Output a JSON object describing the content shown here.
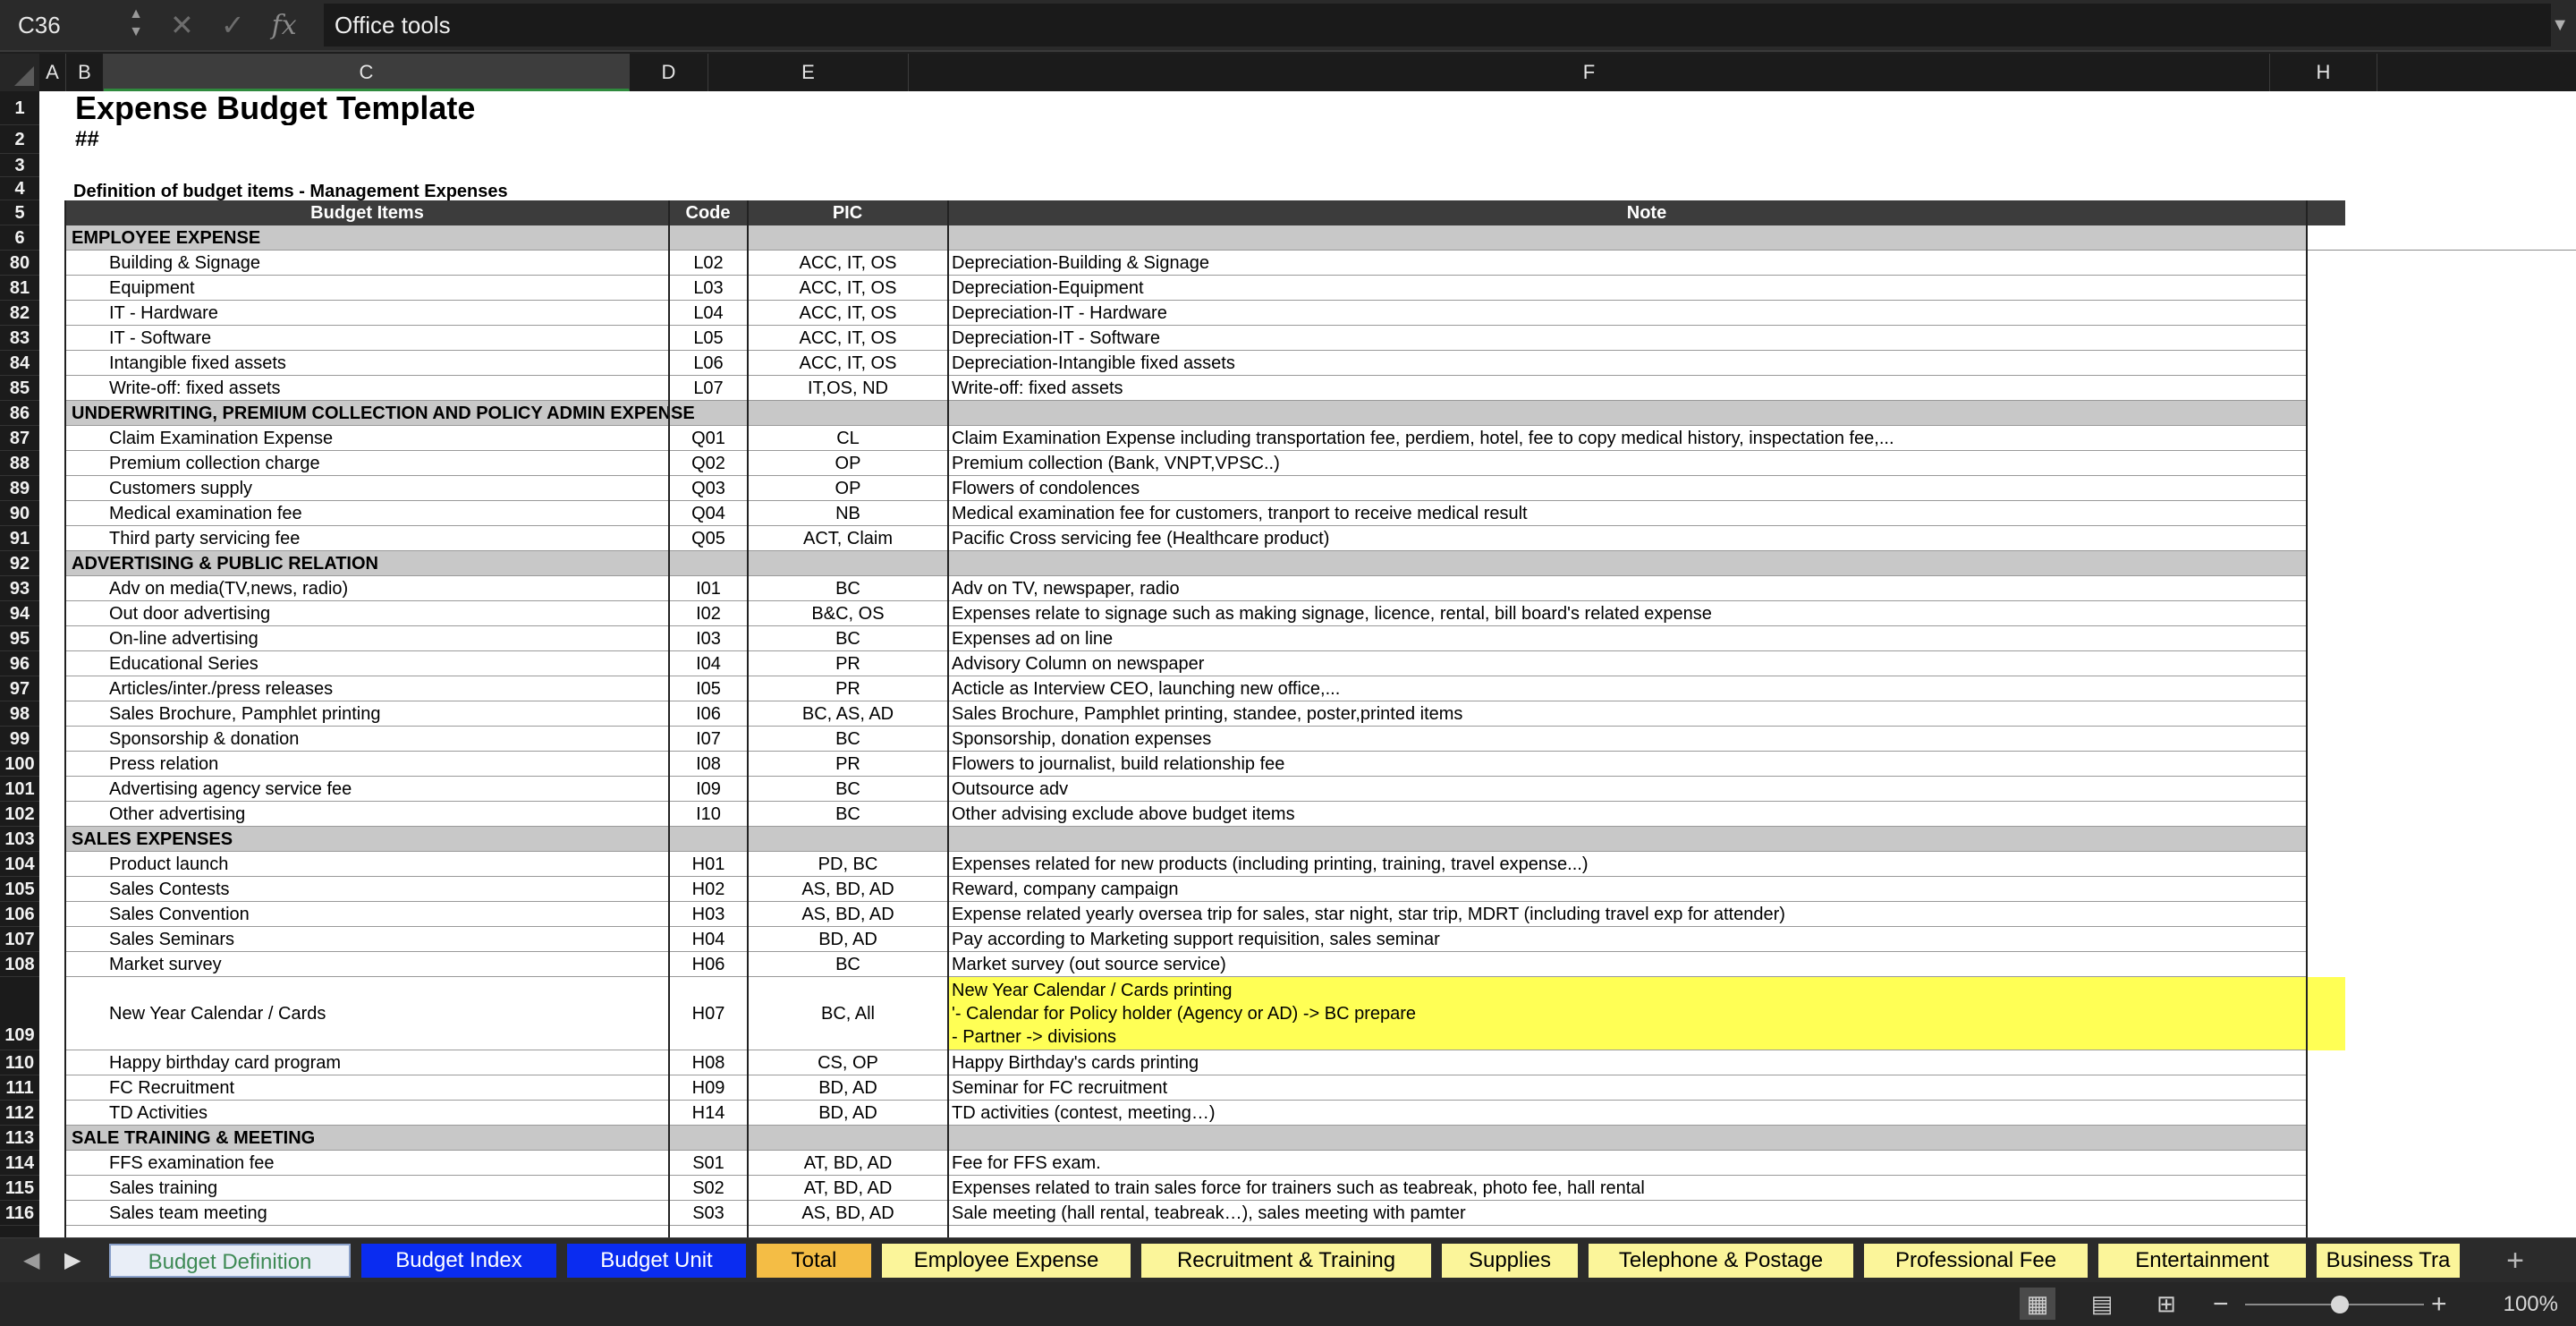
{
  "formula_bar": {
    "cell_ref": "C36",
    "cancel_icon": "✕",
    "confirm_icon": "✓",
    "fx_label": "fx",
    "value": "Office tools"
  },
  "columns": [
    "A",
    "B",
    "C",
    "D",
    "E",
    "F",
    "H"
  ],
  "sheet": {
    "title": "Expense Budget Template",
    "marker": "##",
    "section_label": "Definition of budget items - Management Expenses",
    "headers": {
      "items": "Budget Items",
      "code": "Code",
      "pic": "PIC",
      "note": "Note"
    },
    "rows": [
      {
        "n": "1",
        "kind": "title",
        "item": "Expense Budget Template"
      },
      {
        "n": "2",
        "kind": "marker",
        "item": "##"
      },
      {
        "n": "3",
        "kind": "blank"
      },
      {
        "n": "4",
        "kind": "section",
        "item": "Definition of budget items - Management Expenses"
      },
      {
        "n": "5",
        "kind": "header"
      },
      {
        "n": "6",
        "kind": "group",
        "item": "EMPLOYEE EXPENSE"
      },
      {
        "n": "80",
        "item": "Building & Signage",
        "code": "L02",
        "pic": "ACC, IT, OS",
        "note": "Depreciation-Building & Signage"
      },
      {
        "n": "81",
        "item": "Equipment",
        "code": "L03",
        "pic": "ACC, IT, OS",
        "note": "Depreciation-Equipment"
      },
      {
        "n": "82",
        "item": "IT - Hardware",
        "code": "L04",
        "pic": "ACC, IT, OS",
        "note": "Depreciation-IT - Hardware"
      },
      {
        "n": "83",
        "item": "IT - Software",
        "code": "L05",
        "pic": "ACC, IT, OS",
        "note": "Depreciation-IT - Software"
      },
      {
        "n": "84",
        "item": "Intangible fixed assets",
        "code": "L06",
        "pic": "ACC, IT, OS",
        "note": "Depreciation-Intangible fixed assets"
      },
      {
        "n": "85",
        "item": "Write-off: fixed assets",
        "code": "L07",
        "pic": "IT,OS, ND",
        "note": "Write-off: fixed assets"
      },
      {
        "n": "86",
        "kind": "group",
        "item": "UNDERWRITING, PREMIUM COLLECTION AND POLICY ADMIN EXPENSE"
      },
      {
        "n": "87",
        "item": "Claim Examination Expense",
        "code": "Q01",
        "pic": "CL",
        "note": "Claim Examination Expense including transportation fee, perdiem, hotel, fee to copy medical history, inspectation fee,..."
      },
      {
        "n": "88",
        "item": "Premium collection charge",
        "code": "Q02",
        "pic": "OP",
        "note": "Premium collection (Bank, VNPT,VPSC..)"
      },
      {
        "n": "89",
        "item": "Customers supply",
        "code": "Q03",
        "pic": "OP",
        "note": "Flowers of condolences"
      },
      {
        "n": "90",
        "item": "Medical examination fee",
        "code": "Q04",
        "pic": "NB",
        "note": "Medical examination fee for customers, tranport to receive medical result"
      },
      {
        "n": "91",
        "item": "Third party servicing fee",
        "code": "Q05",
        "pic": "ACT, Claim",
        "note": "Pacific Cross servicing fee (Healthcare product)"
      },
      {
        "n": "92",
        "kind": "group",
        "item": "ADVERTISING & PUBLIC RELATION"
      },
      {
        "n": "93",
        "item": "Adv on media(TV,news, radio)",
        "code": "I01",
        "pic": "BC",
        "note": "Adv on TV, newspaper, radio"
      },
      {
        "n": "94",
        "item": "Out door advertising",
        "code": "I02",
        "pic": "B&C, OS",
        "note": "Expenses relate to signage such as making signage, licence, rental, bill board's related expense"
      },
      {
        "n": "95",
        "item": "On-line advertising",
        "code": "I03",
        "pic": "BC",
        "note": "Expenses ad on line"
      },
      {
        "n": "96",
        "item": "Educational Series",
        "code": "I04",
        "pic": "PR",
        "note": "Advisory Column on newspaper"
      },
      {
        "n": "97",
        "item": "Articles/inter./press releases",
        "code": "I05",
        "pic": "PR",
        "note": "Acticle as Interview CEO, launching new office,..."
      },
      {
        "n": "98",
        "item": "Sales Brochure, Pamphlet printing",
        "code": "I06",
        "pic": "BC, AS, AD",
        "note": "Sales Brochure, Pamphlet printing, standee, poster,printed items"
      },
      {
        "n": "99",
        "item": "Sponsorship & donation",
        "code": "I07",
        "pic": "BC",
        "note": "Sponsorship, donation expenses"
      },
      {
        "n": "100",
        "item": "Press relation",
        "code": "I08",
        "pic": "PR",
        "note": "Flowers to journalist, build relationship fee"
      },
      {
        "n": "101",
        "item": "Advertising agency service fee",
        "code": "I09",
        "pic": "BC",
        "note": "Outsource adv"
      },
      {
        "n": "102",
        "item": "Other advertising",
        "code": "I10",
        "pic": "BC",
        "note": "Other advising exclude above budget items"
      },
      {
        "n": "103",
        "kind": "group",
        "item": "SALES EXPENSES"
      },
      {
        "n": "104",
        "item": "Product launch",
        "code": "H01",
        "pic": "PD, BC",
        "note": "Expenses related for new products (including printing, training, travel expense...)"
      },
      {
        "n": "105",
        "item": "Sales Contests",
        "code": "H02",
        "pic": "AS, BD, AD",
        "note": "Reward, company campaign"
      },
      {
        "n": "106",
        "item": "Sales Convention",
        "code": "H03",
        "pic": "AS, BD, AD",
        "note": "Expense related yearly oversea trip for sales, star night, star trip, MDRT (including travel exp for attender)"
      },
      {
        "n": "107",
        "item": "Sales Seminars",
        "code": "H04",
        "pic": "BD, AD",
        "note": "Pay according to Marketing support requisition, sales seminar"
      },
      {
        "n": "108",
        "item": "Market survey",
        "code": "H06",
        "pic": "BC",
        "note": "Market survey (out source service)"
      },
      {
        "n": "109",
        "kind": "tall",
        "item": "New Year Calendar / Cards",
        "code": "H07",
        "pic": "BC, All",
        "note_lines": [
          "New Year Calendar / Cards printing",
          "'- Calendar for Policy holder (Agency or AD) -> BC prepare",
          "- Partner -> divisions"
        ]
      },
      {
        "n": "110",
        "item": "Happy birthday card program",
        "code": "H08",
        "pic": "CS, OP",
        "note": "Happy Birthday's cards printing"
      },
      {
        "n": "111",
        "item": "FC Recruitment",
        "code": "H09",
        "pic": "BD, AD",
        "note": "Seminar for FC recruitment"
      },
      {
        "n": "112",
        "item": "TD Activities",
        "code": "H14",
        "pic": "BD, AD",
        "note": "TD activities (contest, meeting…)"
      },
      {
        "n": "113",
        "kind": "group",
        "item": "SALE TRAINING & MEETING"
      },
      {
        "n": "114",
        "item": "FFS examination fee",
        "code": "S01",
        "pic": "AT, BD, AD",
        "note": "Fee for FFS exam."
      },
      {
        "n": "115",
        "item": "Sales training",
        "code": "S02",
        "pic": "AT, BD, AD",
        "note": "Expenses related to train sales force for trainers such as teabreak, photo fee, hall rental"
      },
      {
        "n": "116",
        "item": "Sales team meeting",
        "code": "S03",
        "pic": "AS, BD, AD",
        "note": "Sale meeting (hall rental, teabreak…), sales meeting with pamter"
      }
    ]
  },
  "tabs": [
    {
      "label": "Budget Definition",
      "style": "active"
    },
    {
      "label": "Budget Index",
      "style": "blue"
    },
    {
      "label": "Budget Unit",
      "style": "blue"
    },
    {
      "label": "Total",
      "style": "orange"
    },
    {
      "label": "Employee Expense",
      "style": "yel"
    },
    {
      "label": "Recruitment & Training",
      "style": "yel"
    },
    {
      "label": "Supplies",
      "style": "yel"
    },
    {
      "label": "Telephone & Postage",
      "style": "yel"
    },
    {
      "label": "Professional Fee",
      "style": "yel"
    },
    {
      "label": "Entertainment",
      "style": "yel"
    },
    {
      "label": "Business Tra",
      "style": "yel"
    }
  ],
  "tab_nav": {
    "prev": "◀",
    "next": "▶",
    "add": "+"
  },
  "status": {
    "zoom": "100%",
    "zoom_level": 0.53,
    "zoom_minus": "−",
    "zoom_plus": "+"
  }
}
